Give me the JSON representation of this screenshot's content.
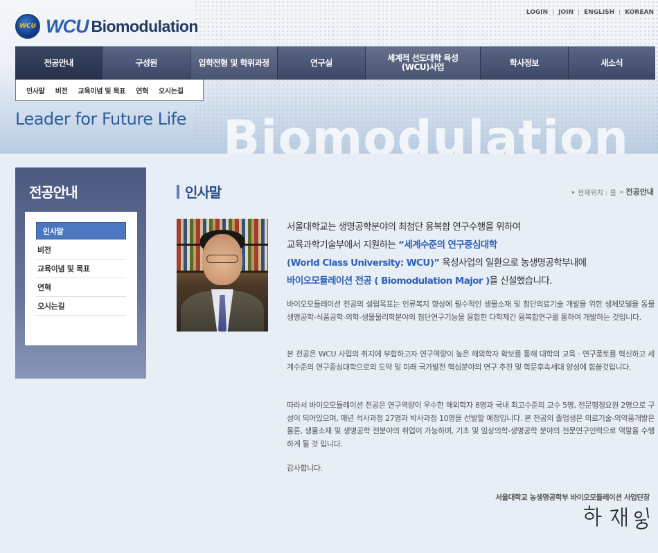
{
  "header": {
    "logo_badge": "WCU",
    "logo_wcu": "WCU",
    "logo_brand": "Biomodulation",
    "util_links": [
      "LOGIN",
      "JOIN",
      "ENGLISH",
      "KOREAN"
    ]
  },
  "gnb": [
    {
      "label": "전공안내"
    },
    {
      "label": "구성원"
    },
    {
      "label": "입학전형 및 학위과정"
    },
    {
      "label": "연구실"
    },
    {
      "label": "세계적 선도대학 육성(WCU)사업"
    },
    {
      "label": "학사정보"
    },
    {
      "label": "새소식"
    }
  ],
  "subnav": [
    "인사말",
    "비전",
    "교육이념 및 목표",
    "연혁",
    "오시는길"
  ],
  "hero": {
    "slogan": "Leader for Future Life",
    "watermark": "Biomodulation"
  },
  "lnb": {
    "title": "전공안내",
    "items": [
      "인사말",
      "비전",
      "교육이념 및 목표",
      "연혁",
      "오시는길"
    ],
    "active_index": 0
  },
  "content": {
    "page_title": "인사말",
    "breadcrumb": {
      "prefix": "현재위치 : 홈",
      "current": "전공안내"
    },
    "lead": {
      "l1": "서울대학교는 생명공학분야의 최첨단 융복합 연구수행을 위하여",
      "l2a": "교육과학기술부에서 지원하는 ",
      "l2b": "“세계수준의 연구중심대학",
      "l3a": "(World Class University: WCU)”",
      "l3b": " 육성사업의 일환으로 농생명공학부내에",
      "l4a": "바이오모듈레이션 전공 ( Biomodulation Major )",
      "l4b": "을 신설했습니다."
    },
    "paragraphs": [
      "바이오모듈레이션 전공의 설립목표는 인류복지 향상에 필수적인 생물소재 및 첨단의료기술 개발을 위한 생체모델을 동물생명공학-식품공학-의학-생물물리학분야의 첨단연구기능을 융합한 다학제간 융복합연구를 통하여 개발하는 것입니다.",
      "본 전공은 WCU 사업의 취지에 부합하고자 연구역량이 높은 해외학자 확보를 통해 대학의 교육 · 연구풍토를 혁신하고 세계수준의 연구중심대학으로의 도약 및 미래 국가발전 핵심분야의 연구 추진 및 학문후속세대 양성에 힘쓸것입니다.",
      "따라서 바이오모듈레이션 전공은 연구역량이 우수한 해외학자 8명과 국내 최고수준의 교수 5명, 전문행정요원 2명으로 구성이 되어있으며, 매년 석사과정 27명과 박사과정 10명을 선발할 예정입니다. 본 전공의 졸업생은 의료기술-의약품개발은 물론, 생물소재 및 생명공학 전분야의 취업이 가능하며, 기초 및 임상의학-생명공학 분야의 전문연구인력으로 역할을 수행하게 될 것 입니다.",
      "감사합니다."
    ],
    "signoff": "서울대학교 농생명공학부 바이오모듈레이션 사업단장",
    "signature_text": "한 재 용"
  }
}
